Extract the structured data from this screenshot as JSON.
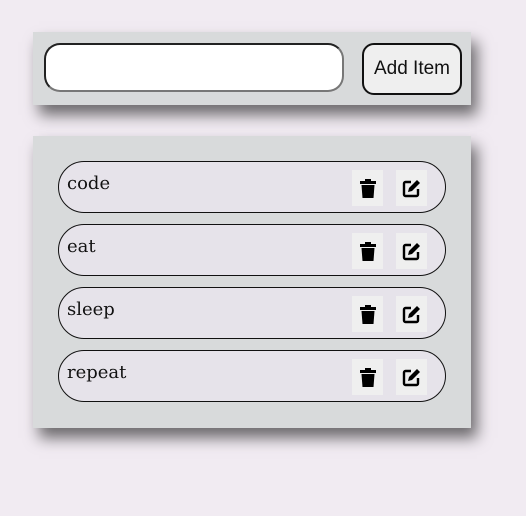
{
  "input": {
    "value": "",
    "placeholder": ""
  },
  "add_button": {
    "label": "Add Item"
  },
  "items": [
    {
      "label": "code",
      "delete_icon": "trash-icon",
      "edit_icon": "edit-icon"
    },
    {
      "label": "eat",
      "delete_icon": "trash-icon",
      "edit_icon": "edit-icon"
    },
    {
      "label": "sleep",
      "delete_icon": "trash-icon",
      "edit_icon": "edit-icon"
    },
    {
      "label": "repeat",
      "delete_icon": "trash-icon",
      "edit_icon": "edit-icon"
    }
  ]
}
